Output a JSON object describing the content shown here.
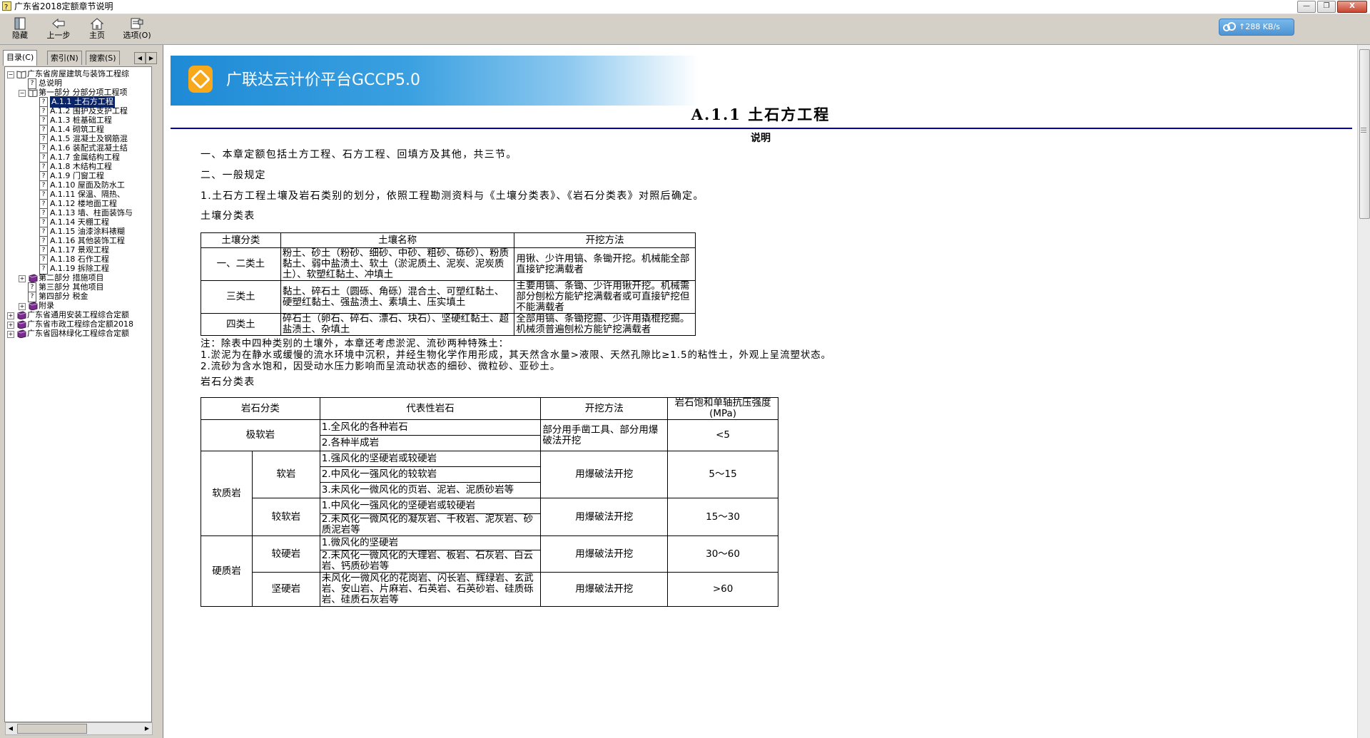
{
  "window": {
    "title": "广东省2018定额章节说明",
    "buttons": [
      "—",
      "❐",
      "X"
    ]
  },
  "toolbar": {
    "buttons": [
      {
        "label": "隐藏",
        "icon": "hide-icon"
      },
      {
        "label": "上一步",
        "icon": "back-arrow-icon"
      },
      {
        "label": "主页",
        "icon": "home-icon"
      },
      {
        "label": "选项(O)",
        "icon": "options-icon"
      }
    ],
    "network_speed": "↑288 KB/s"
  },
  "sidebar": {
    "tabs": [
      "目录(C)",
      "索引(N)",
      "搜索(S)"
    ],
    "tree": [
      {
        "label": "广东省房屋建筑与装饰工程综",
        "level": 0,
        "icon": "book-open",
        "expander": "−"
      },
      {
        "label": "总说明",
        "level": 1,
        "icon": "page"
      },
      {
        "label": "第一部分 分部分项工程项",
        "level": 1,
        "icon": "book-open",
        "expander": "−"
      },
      {
        "label": "A.1.1 土石方工程",
        "level": 2,
        "icon": "page",
        "selected": true
      },
      {
        "label": "A.1.2 围护及支护工程",
        "level": 2,
        "icon": "page"
      },
      {
        "label": "A.1.3 桩基础工程",
        "level": 2,
        "icon": "page"
      },
      {
        "label": "A.1.4 砌筑工程",
        "level": 2,
        "icon": "page"
      },
      {
        "label": "A.1.5 混凝土及钢筋混",
        "level": 2,
        "icon": "page"
      },
      {
        "label": "A.1.6 装配式混凝土结",
        "level": 2,
        "icon": "page"
      },
      {
        "label": "A.1.7 金属结构工程",
        "level": 2,
        "icon": "page"
      },
      {
        "label": "A.1.8 木结构工程",
        "level": 2,
        "icon": "page"
      },
      {
        "label": "A.1.9 门窗工程",
        "level": 2,
        "icon": "page"
      },
      {
        "label": "A.1.10 屋面及防水工",
        "level": 2,
        "icon": "page"
      },
      {
        "label": "A.1.11 保温、隔热、",
        "level": 2,
        "icon": "page"
      },
      {
        "label": "A.1.12 楼地面工程",
        "level": 2,
        "icon": "page"
      },
      {
        "label": "A.1.13 墙、柱面装饰与",
        "level": 2,
        "icon": "page"
      },
      {
        "label": "A.1.14 天棚工程",
        "level": 2,
        "icon": "page"
      },
      {
        "label": "A.1.15 油漆涂料裱糊",
        "level": 2,
        "icon": "page"
      },
      {
        "label": "A.1.16 其他装饰工程",
        "level": 2,
        "icon": "page"
      },
      {
        "label": "A.1.17 景观工程",
        "level": 2,
        "icon": "page"
      },
      {
        "label": "A.1.18 石作工程",
        "level": 2,
        "icon": "page"
      },
      {
        "label": "A.1.19 拆除工程",
        "level": 2,
        "icon": "page"
      },
      {
        "label": "第二部分 措施项目",
        "level": 1,
        "icon": "book-closed",
        "expander": "+"
      },
      {
        "label": "第三部分 其他项目",
        "level": 1,
        "icon": "page"
      },
      {
        "label": "第四部分 税金",
        "level": 1,
        "icon": "page"
      },
      {
        "label": "附录",
        "level": 1,
        "icon": "book-closed",
        "expander": "+"
      },
      {
        "label": "广东省通用安装工程综合定额",
        "level": 0,
        "icon": "book-closed",
        "expander": "+"
      },
      {
        "label": "广东省市政工程综合定额2018",
        "level": 0,
        "icon": "book-closed",
        "expander": "+"
      },
      {
        "label": "广东省园林绿化工程综合定额",
        "level": 0,
        "icon": "book-closed",
        "expander": "+"
      }
    ]
  },
  "banner": {
    "title": "广联达云计价平台GCCP5.0"
  },
  "document": {
    "title": "A.1.1 土石方工程",
    "subtitle": "说明",
    "p1": "一、本章定额包括土方工程、石方工程、回填方及其他，共三节。",
    "p2": "二、一般规定",
    "p3": "1.土石方工程土壤及岩石类别的划分，依照工程勘测资料与《土壤分类表》、《岩石分类表》对照后确定。",
    "soil_table_caption": "土壤分类表",
    "soil_table": {
      "headers": [
        "土壤分类",
        "土壤名称",
        "开挖方法"
      ],
      "rows": [
        {
          "cls": "一、二类土",
          "name": "粉土、砂土（粉砂、细砂、中砂、粗砂、砾砂）、粉质黏土、弱中盐渍土、软土（淤泥质土、泥炭、泥炭质土）、软塑红黏土、冲填土",
          "method": "用锹、少许用镐、条锄开挖。机械能全部直接铲挖满载者"
        },
        {
          "cls": "三类土",
          "name": "黏土、碎石土（圆砾、角砾）混合土、可塑红黏土、硬塑红黏土、强盐渍土、素填土、压实填土",
          "method": "主要用镐、条锄、少许用锹开挖。机械需部分刨松方能铲挖满载者或可直接铲挖但不能满载者"
        },
        {
          "cls": "四类土",
          "name": "碎石土（卵石、碎石、漂石、块石）、坚硬红黏土、超盐渍土、杂填土",
          "method": "全部用镐、条锄挖掘、少许用撬棍挖掘。机械须普遍刨松方能铲挖满载者"
        }
      ]
    },
    "note1": "注：除表中四种类别的土壤外，本章还考虑淤泥、流砂两种特殊土：",
    "note2": "1.淤泥为在静水或缓慢的流水环境中沉积，并经生物化学作用形成，其天然含水量>液限、天然孔隙比≥1.5的粘性土，外观上呈流塑状态。",
    "note3": "2.流砂为含水饱和，因受动水压力影响而呈流动状态的细砂、微粒砂、亚砂土。",
    "rock_table_caption": "岩石分类表",
    "rock_table": {
      "headers": [
        "岩石分类",
        "代表性岩石",
        "开挖方法",
        "岩石饱和单轴抗压强度(MPa)"
      ],
      "extremely_soft": "极软岩",
      "es_rock1": "1.全风化的各种岩石",
      "es_rock2": "2.各种半成岩",
      "es_method": "部分用手凿工具、部分用爆破法开挖",
      "es_strength": "<5",
      "soft_group": "软质岩",
      "soft": "软岩",
      "soft_rock1": "1.强风化的坚硬岩或较硬岩",
      "soft_rock2": "2.中风化一强风化的较软岩",
      "soft_rock3": "3.未风化一微风化的页岩、泥岩、泥质砂岩等",
      "soft_method": "用爆破法开挖",
      "soft_strength": "5～15",
      "rsoft": "较软岩",
      "rsoft_rock1": "1.中风化一强风化的坚硬岩或较硬岩",
      "rsoft_rock2": "2.未风化一微风化的凝灰岩、千枚岩、泥灰岩、砂质泥岩等",
      "rsoft_method": "用爆破法开挖",
      "rsoft_strength": "15～30",
      "hard_group": "硬质岩",
      "rhard": "较硬岩",
      "rhard_rock1": "1.微风化的坚硬岩",
      "rhard_rock2": "2.未风化一微风化的大理岩、板岩、石灰岩、白云岩、钙质砂岩等",
      "rhard_method": "用爆破法开挖",
      "rhard_strength": "30～60",
      "hard": "坚硬岩",
      "hard_rock": "未风化一微风化的花岗岩、闪长岩、辉绿岩、玄武岩、安山岩、片麻岩、石英岩、石英砂岩、硅质砾岩、硅质石灰岩等",
      "hard_method": "用爆破法开挖",
      "hard_strength": ">60"
    }
  },
  "colors": {
    "rule": "#0000aa",
    "banner": "#1e8ad6",
    "selection": "#0a246a"
  }
}
